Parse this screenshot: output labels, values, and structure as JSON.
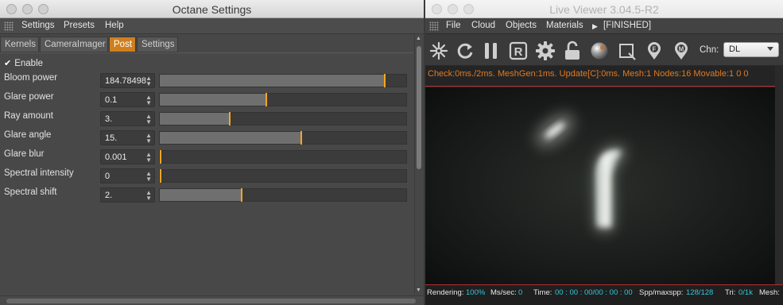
{
  "left_window": {
    "title": "Octane Settings",
    "menu": [
      "Settings",
      "Presets",
      "Help"
    ],
    "tabs": [
      "Kernels",
      "CameraImager",
      "Post",
      "Settings"
    ],
    "active_tab": "Post",
    "enable_label": "Enable",
    "enable_checked": true,
    "rows": [
      {
        "label": "Bloom power",
        "value": "184.78498",
        "level": 0.91
      },
      {
        "label": "Glare power",
        "value": "0.1",
        "level": 0.43
      },
      {
        "label": "Ray amount",
        "value": "3.",
        "level": 0.28
      },
      {
        "label": "Glare angle",
        "value": "15.",
        "level": 0.57
      },
      {
        "label": "Glare blur",
        "value": "0.001",
        "level": 0.0
      },
      {
        "label": "Spectral intensity",
        "value": "0",
        "level": 0.0
      },
      {
        "label": "Spectral shift",
        "value": "2.",
        "level": 0.33
      }
    ],
    "accent_color": "#f5a623",
    "active_tab_color": "#cf7f1e"
  },
  "right_window": {
    "title": "Live Viewer 3.04.5-R2",
    "menu": [
      "File",
      "Cloud",
      "Objects",
      "Materials",
      "[FINISHED]"
    ],
    "toolbar_icons": [
      "send-scene-icon",
      "restart-icon",
      "pause-icon",
      "region-render-icon",
      "settings-gear-icon",
      "lock-icon",
      "material-ball-icon",
      "focus-picker-icon",
      "f-pin-icon",
      "m-pin-icon"
    ],
    "channel_label": "Chn:",
    "channel_value": "DL",
    "status_text": "Check:0ms./2ms. MeshGen:1ms. Update[C]:0ms. Mesh:1 Nodes:16 Movable:1  0 0",
    "footer": {
      "rendering_label": "Rendering:",
      "rendering_value": "100%",
      "ms_label": "Ms/sec:",
      "ms_value": "0",
      "time_label": "Time:",
      "time_value": "00 : 00 : 00/00 : 00 : 00",
      "spp_label": "Spp/maxspp:",
      "spp_value": "128/128",
      "tri_label": "Tri:",
      "tri_value": "0/1k",
      "mesh_label": "Mesh:"
    },
    "status_color": "#e07a22",
    "footer_value_color": "#34c7d9"
  }
}
